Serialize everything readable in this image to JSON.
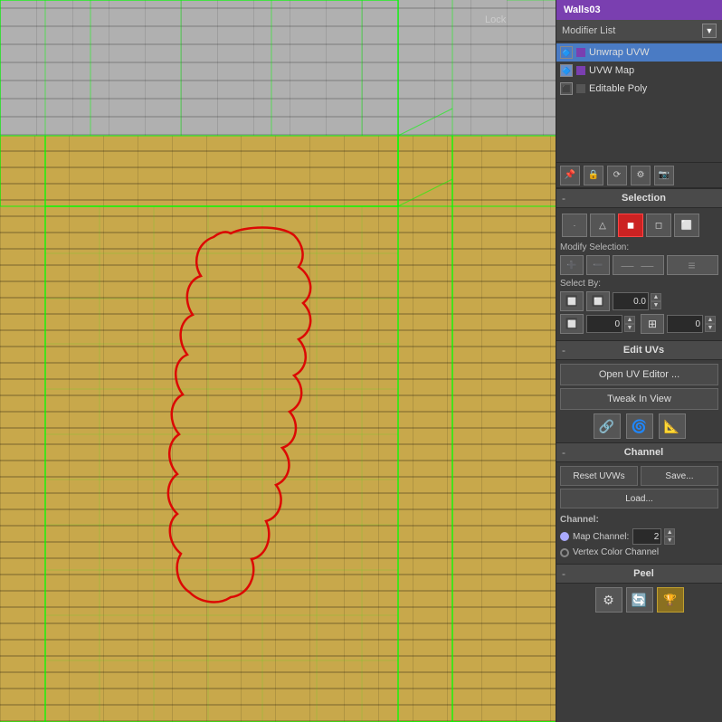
{
  "title": "Walls03",
  "modifier_list": {
    "label": "Modifier List",
    "items": [
      {
        "name": "Unwrap UVW",
        "active": true,
        "icon": "U"
      },
      {
        "name": "UVW Map",
        "active": false,
        "icon": "U"
      },
      {
        "name": "Editable Poly",
        "active": false,
        "icon": "E"
      }
    ]
  },
  "toolbar": {
    "buttons": [
      "⟵",
      "🔒",
      "⟳",
      "⚙",
      "📷"
    ]
  },
  "selection": {
    "title": "Selection",
    "subobj_buttons": [
      "·",
      "△",
      "◼",
      "◻"
    ],
    "modify_selection_label": "Modify Selection:",
    "select_by_label": "Select By:",
    "spinbox1_value": "0.0",
    "spinbox2_value": "0",
    "spinbox3_value": "0"
  },
  "edit_uvs": {
    "title": "Edit UVs",
    "open_uv_editor": "Open UV Editor ...",
    "tweak_in_view": "Tweak In View"
  },
  "channel": {
    "title": "Channel",
    "reset_uvws": "Reset UVWs",
    "save": "Save...",
    "load": "Load...",
    "channel_label": "Channel:",
    "map_channel_label": "Map Channel:",
    "map_channel_value": "2",
    "vertex_color_channel": "Vertex Color Channel"
  },
  "peel": {
    "title": "Peel"
  }
}
